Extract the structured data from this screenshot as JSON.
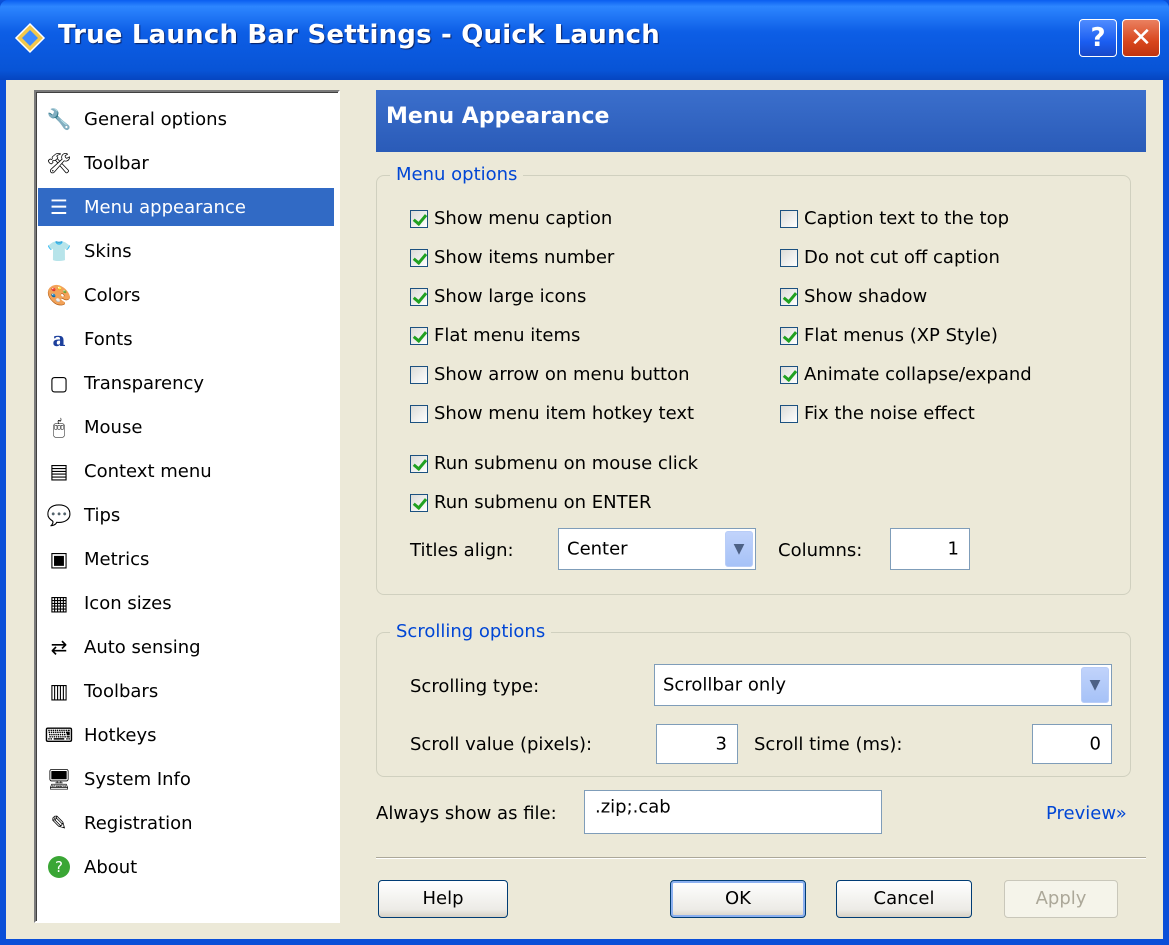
{
  "window": {
    "title": "True Launch Bar Settings - Quick Launch",
    "help_glyph": "?",
    "close_glyph": "✕"
  },
  "nav": {
    "items": [
      {
        "label": "General options",
        "icon": "wrench-icon"
      },
      {
        "label": "Toolbar",
        "icon": "toolbar-icon"
      },
      {
        "label": "Menu appearance",
        "icon": "menu-icon"
      },
      {
        "label": "Skins",
        "icon": "skins-icon"
      },
      {
        "label": "Colors",
        "icon": "colors-icon"
      },
      {
        "label": "Fonts",
        "icon": "fonts-icon"
      },
      {
        "label": "Transparency",
        "icon": "transparency-icon"
      },
      {
        "label": "Mouse",
        "icon": "mouse-icon"
      },
      {
        "label": "Context menu",
        "icon": "context-menu-icon"
      },
      {
        "label": "Tips",
        "icon": "tips-icon"
      },
      {
        "label": "Metrics",
        "icon": "metrics-icon"
      },
      {
        "label": "Icon sizes",
        "icon": "icon-sizes-icon"
      },
      {
        "label": "Auto sensing",
        "icon": "auto-sensing-icon"
      },
      {
        "label": "Toolbars",
        "icon": "toolbars-icon"
      },
      {
        "label": "Hotkeys",
        "icon": "hotkeys-icon"
      },
      {
        "label": "System Info",
        "icon": "system-info-icon"
      },
      {
        "label": "Registration",
        "icon": "registration-icon"
      },
      {
        "label": "About",
        "icon": "about-icon"
      }
    ],
    "selected": "Menu appearance"
  },
  "header": {
    "title": "Menu Appearance"
  },
  "menu_options": {
    "legend": "Menu options",
    "left": [
      {
        "label": "Show menu caption",
        "checked": true
      },
      {
        "label": "Show items number",
        "checked": true
      },
      {
        "label": "Show large icons",
        "checked": true
      },
      {
        "label": "Flat menu items",
        "checked": true
      },
      {
        "label": "Show arrow on menu button",
        "checked": false
      },
      {
        "label": "Show menu item hotkey text",
        "checked": false
      }
    ],
    "right": [
      {
        "label": "Caption text to the top",
        "checked": false
      },
      {
        "label": "Do not cut off caption",
        "checked": false
      },
      {
        "label": "Show shadow",
        "checked": true
      },
      {
        "label": "Flat menus (XP Style)",
        "checked": true
      },
      {
        "label": "Animate collapse/expand",
        "checked": true
      },
      {
        "label": "Fix the noise effect",
        "checked": false
      }
    ],
    "submenu": [
      {
        "label": "Run submenu on mouse click",
        "checked": true
      },
      {
        "label": "Run submenu on ENTER",
        "checked": true
      }
    ],
    "titles_align_label": "Titles align:",
    "titles_align_value": "Center",
    "columns_label": "Columns:",
    "columns_value": "1"
  },
  "scrolling_options": {
    "legend": "Scrolling options",
    "type_label": "Scrolling type:",
    "type_value": "Scrollbar only",
    "value_label": "Scroll value (pixels):",
    "value": "3",
    "time_label": "Scroll time (ms):",
    "time": "0"
  },
  "always_show": {
    "label": "Always show as file:",
    "value": ".zip;.cab"
  },
  "preview_link": "Preview»",
  "buttons": {
    "help": "Help",
    "ok": "OK",
    "cancel": "Cancel",
    "apply": "Apply"
  },
  "colors": {
    "titlebar": "#0a5ef0",
    "header": "#3b6fcc",
    "selection": "#316ac5",
    "link": "#0046d5"
  }
}
